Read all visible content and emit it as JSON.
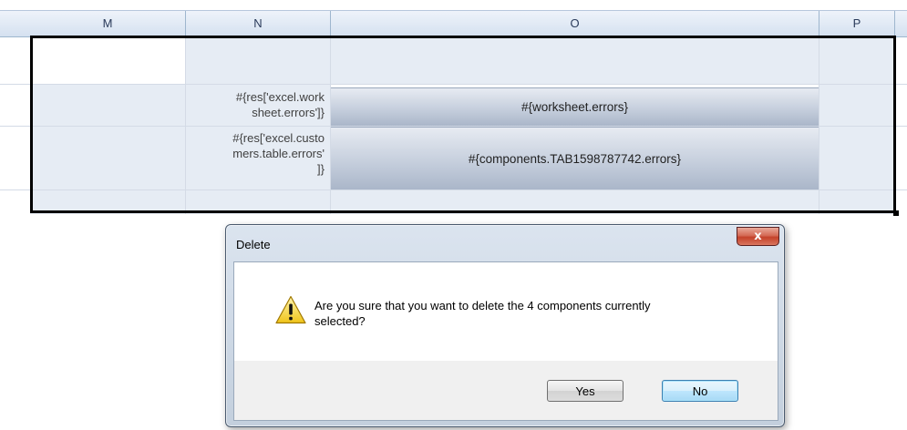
{
  "sheet": {
    "columns": [
      "M",
      "N",
      "O",
      "P"
    ],
    "rows": [
      {
        "label": "#{res['excel.worksheet.errors']}",
        "label_lines": [
          "#{res['excel.work",
          "sheet.errors']}"
        ],
        "value": "#{worksheet.errors}"
      },
      {
        "label": "#{res['excel.customers.table.errors']}",
        "label_lines": [
          "#{res['excel.custo",
          "mers.table.errors'",
          "]}"
        ],
        "value": "#{components.TAB1598787742.errors}"
      }
    ]
  },
  "dialog": {
    "title": "Delete",
    "close_glyph": "x",
    "icon": "warning-icon",
    "message": "Are you sure that you want to delete the 4 components currently selected?",
    "message_lines": [
      "Are you sure that you want to delete the 4 components currently",
      "selected?"
    ],
    "buttons": {
      "yes": "Yes",
      "no": "No"
    },
    "default_button": "No"
  }
}
